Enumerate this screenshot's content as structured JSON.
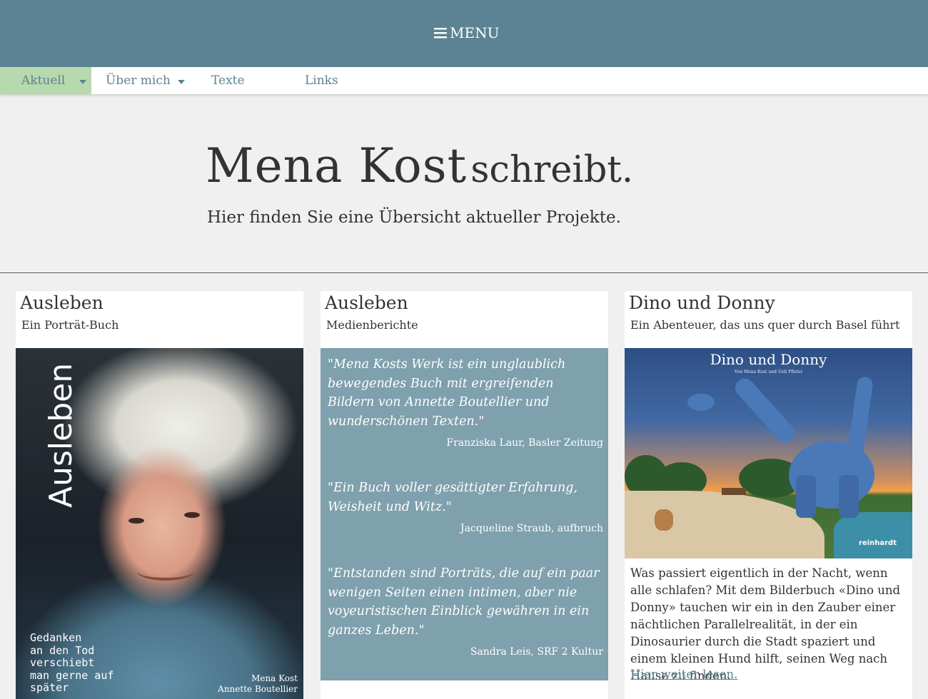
{
  "header": {
    "menu_label": "MENU"
  },
  "nav": {
    "items": [
      {
        "label": "Aktuell"
      },
      {
        "label": "Über mich"
      },
      {
        "label": "Texte"
      },
      {
        "label": "Links"
      }
    ]
  },
  "hero": {
    "title_name": "Mena Kost",
    "title_verb": "schreibt.",
    "subtitle": "Hier finden Sie eine Übersicht aktueller Projekte."
  },
  "cards": [
    {
      "title": "Ausleben",
      "subtitle": "Ein Porträt-Buch",
      "cover": {
        "title": "Ausleben",
        "tagline": [
          "Gedanken",
          "an den Tod",
          "verschiebt",
          "man gerne auf",
          "später"
        ],
        "authors": [
          "Mena Kost",
          "Annette Boutellier"
        ]
      }
    },
    {
      "title": "Ausleben",
      "subtitle": "Medienberichte",
      "quotes": [
        {
          "text": "\"Mena Kosts Werk ist ein unglaublich bewegendes Buch mit ergreifenden Bildern von Annette Boutellier und wunderschönen Texten.\"",
          "source": "Franziska Laur, Basler Zeitung"
        },
        {
          "text": "\"Ein Buch voller gesättigter Erfahrung, Weisheit und Witz.\"",
          "source": "Jacqueline Straub, aufbruch"
        },
        {
          "text": "\"Entstanden sind Porträts, die auf ein paar wenigen Seiten einen intimen, aber nie voyeuristischen Einblick gewähren in ein ganzes Leben.\"",
          "source": "Sandra Leis, SRF 2 Kultur"
        }
      ]
    },
    {
      "title": "Dino und Donny",
      "subtitle": "Ein Abenteuer, das uns quer durch Basel führt",
      "cover": {
        "title": "Dino und Donny",
        "authors": "Von Mena Kost und Ueli Pfister",
        "publisher": "reinhardt"
      },
      "description": "Was passiert eigentlich in der Nacht, wenn alle schlafen? Mit dem Bilderbuch «Dino und Donny» tauchen wir ein in den Zauber einer nächtlichen Parallelrealität, in der ein Dinosaurier durch die Stadt spaziert und einem kleinen Hund hilft, seinen Weg nach Hause zu finden.",
      "link": "Hier weiter lesen."
    }
  ],
  "colors": {
    "header_bg": "#5b8393",
    "nav_active": "#b7d9ae",
    "quote_bg": "#7fa0ad",
    "page_bg": "#f0f0f0"
  }
}
